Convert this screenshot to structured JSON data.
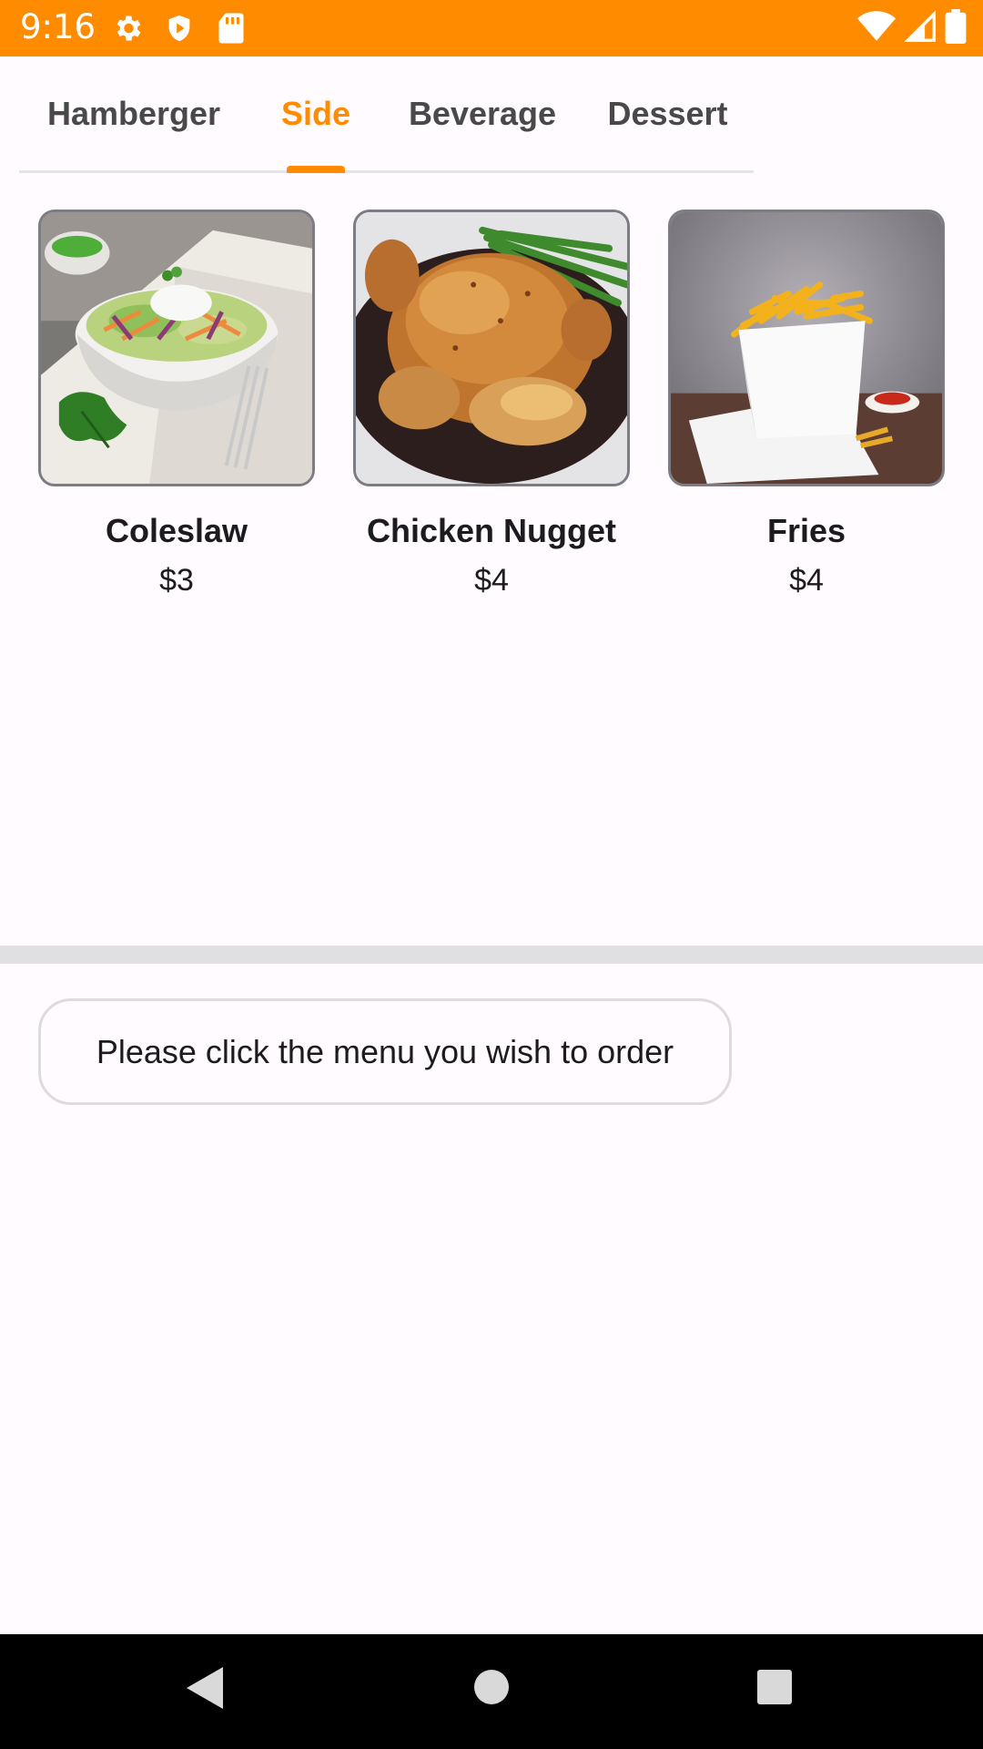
{
  "status_bar": {
    "time": "9:16",
    "left_icons": [
      "gear-icon",
      "shield-play-icon",
      "sd-card-icon"
    ],
    "right_icons": [
      "wifi-icon",
      "signal-icon",
      "battery-icon"
    ],
    "color": "#ff8c00"
  },
  "tabs": [
    {
      "label": "Hamberger",
      "active": false
    },
    {
      "label": "Side",
      "active": true
    },
    {
      "label": "Beverage",
      "active": false
    },
    {
      "label": "Dessert",
      "active": false
    }
  ],
  "accent_color": "#ff8c00",
  "menu_items": [
    {
      "name": "Coleslaw",
      "price": "$3",
      "image": "coleslaw-image"
    },
    {
      "name": "Chicken Nugget",
      "price": "$4",
      "image": "roast-chicken-image"
    },
    {
      "name": "Fries",
      "price": "$4",
      "image": "fries-image"
    }
  ],
  "message": "Please click the menu you wish to order",
  "nav_bar": {
    "buttons": [
      "back-icon",
      "home-icon",
      "recents-icon"
    ]
  }
}
